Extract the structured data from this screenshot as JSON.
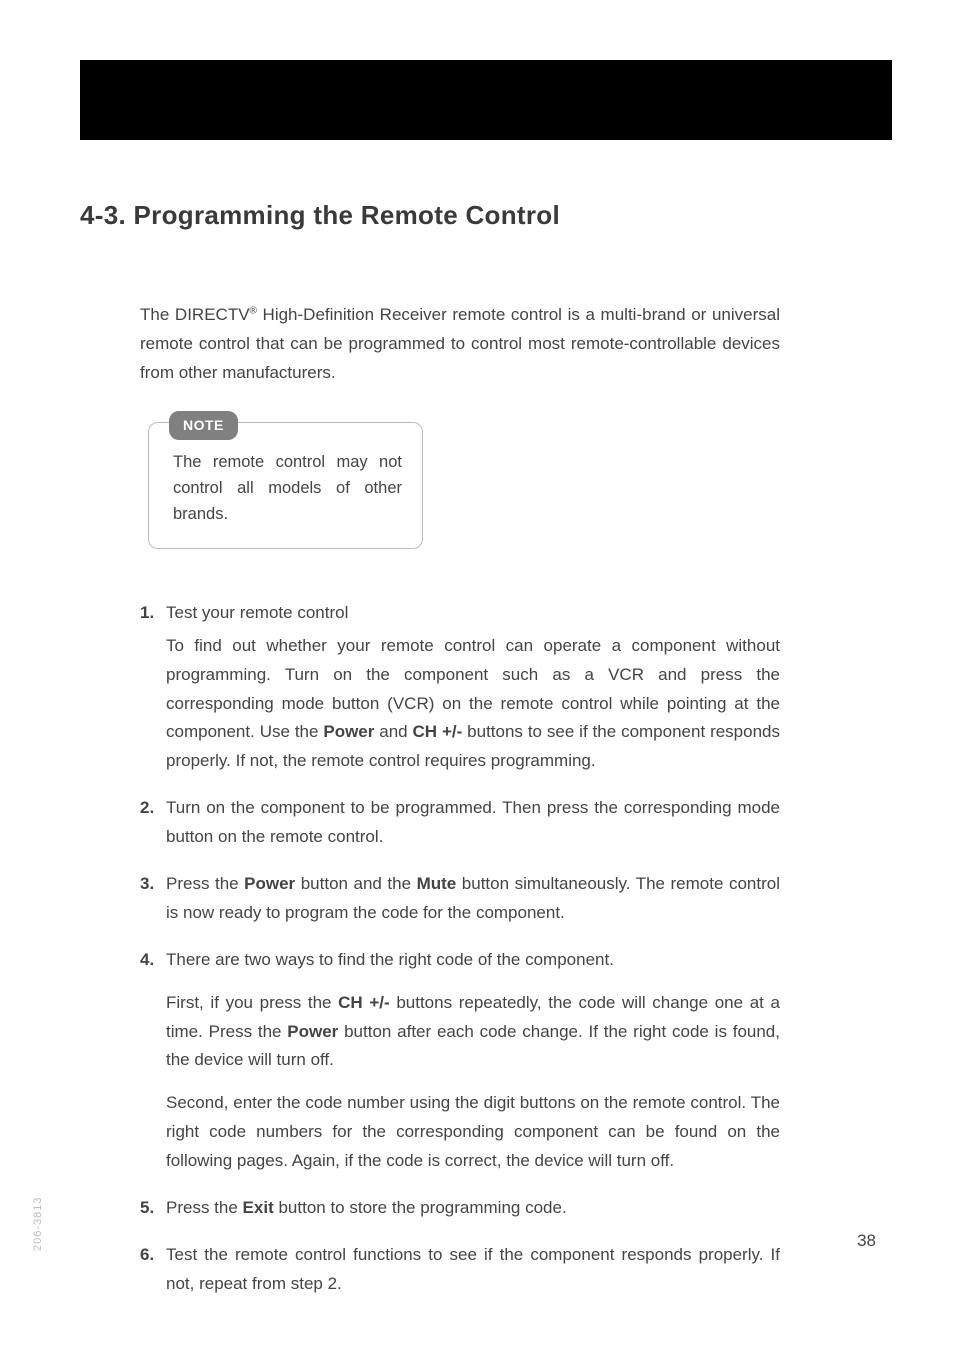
{
  "heading": "4-3. Programming the Remote Control",
  "intro": {
    "prefix": "The DIRECTV",
    "sup": "®",
    "rest": " High-Definition Receiver remote control is a multi-brand or universal remote control that can be programmed to control most remote-controllable devices from other manufacturers."
  },
  "note": {
    "label": "NOTE",
    "text": "The remote control may not control all models of other brands."
  },
  "steps": {
    "s1": {
      "lead": "Test your remote control",
      "body_a": "To find out whether your remote control can operate a component without programming. Turn on the component such as a VCR and press the corresponding mode button (VCR) on the remote control while pointing at the component.  Use the ",
      "bold_power": "Power",
      "mid_and": " and ",
      "bold_ch": "CH +/-",
      "body_b": " buttons to see if the component responds properly. If not, the remote control requires programming."
    },
    "s2": {
      "text": "Turn on the component to be programmed.  Then press the corresponding mode button on the remote control."
    },
    "s3": {
      "a": "Press the ",
      "bold_power": "Power",
      "b": " button and the ",
      "bold_mute": "Mute",
      "c": " button simultaneously.  The remote control is now ready to program the code for the component."
    },
    "s4": {
      "lead": "There are two ways to find the right code of the component.",
      "p1_a": "First, if you press the ",
      "p1_bold_ch": "CH +/-",
      "p1_b": " buttons repeatedly, the code will change one at a time.  Press the ",
      "p1_bold_power": "Power",
      "p1_c": " button after each code change.  If the right code is found, the device will turn off.",
      "p2": "Second, enter the code number using the digit buttons on the remote control.  The right code numbers for the corresponding component can be found on the following pages. Again, if the code is correct, the device will turn off."
    },
    "s5": {
      "a": "Press the ",
      "bold_exit": "Exit",
      "b": " button to store the programming code."
    },
    "s6": {
      "text": "Test the remote control functions to see if the component responds properly.  If not, repeat from step 2."
    }
  },
  "page_number": "38",
  "side_code": "206-3813"
}
